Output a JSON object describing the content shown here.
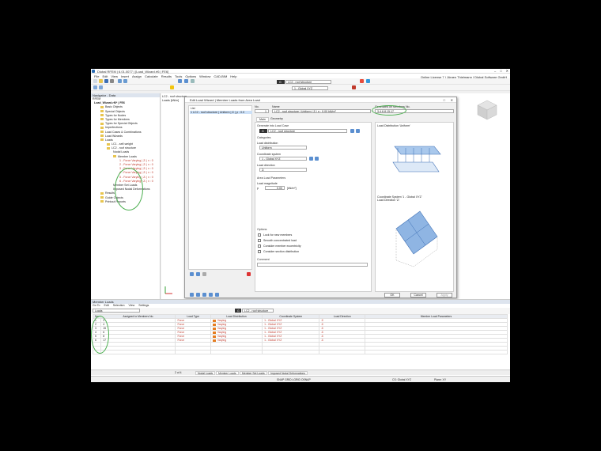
{
  "window": {
    "title": "Dlubal RFEM | 6.01.0077 | [Load_Wizard.rf6 | FE6]",
    "close": "✕"
  },
  "menu": [
    "File",
    "Edit",
    "View",
    "Insert",
    "Assign",
    "Calculate",
    "Results",
    "Tools",
    "Options",
    "Window",
    "CAD-BIM",
    "Help"
  ],
  "license": "Online License 7 | Jürgen Thielmann | Dlubal Software GmbH",
  "toolbar": {
    "loadcase_tag": "G",
    "loadcase": "LC2 - roof structure",
    "cs": "1 - Global XYZ"
  },
  "navigator": {
    "header": "Navigator - Data",
    "project": "RFEM",
    "model": "Load_Wizard.rf6* | FE6",
    "items": [
      "Basic Objects",
      "Special Objects",
      "Types for Nodes",
      "Types for Members",
      "Types for Special Objects",
      "Imperfections",
      "Load Cases & Combinations",
      "Load Wizards",
      "Loads",
      "LC1 - self-weight",
      "LC2 - roof structure",
      "Nodal Loads",
      "Member Loads",
      "1 - Force Varying | Zₗ | x : 0",
      "2 - Force Varying | Zₗ | x : 0",
      "3 - Force Varying | Zₗ | x : 0",
      "4 - Force Varying | Zₗ | x : 0",
      "5 - Force Varying | Zₗ | x : 0",
      "6 - Force Varying | Zₗ | x : 0",
      "Member Set Loads",
      "Imposed Nodal Deformations",
      "Results",
      "Guide Objects",
      "Printout Reports"
    ]
  },
  "viewport": {
    "line1": "LC2 - roof structure",
    "line2": "Loads [kN/m]",
    "cube": "+X"
  },
  "dialog": {
    "title": "Edit Load Wizard | Member Loads from Area Load",
    "list_header": "List",
    "list_item": "1  LC2 - roof structure | Uniform | Zₗ | p : 0.0",
    "no_label": "No.",
    "no_value": "1",
    "name_label": "Name",
    "name_value": "LC2 - roof structure | Uniform | Zₗ | p : 0.00 kN/m²",
    "gen_label": "Generated on Members No.",
    "gen_value": "3,4,6,8,15,17",
    "tabs": [
      "Main",
      "Geometry"
    ],
    "gen_lc_label": "Generate into Load Case",
    "gen_lc_tag": "G",
    "gen_lc_value": "LC2 - roof structure",
    "categories": "Categories",
    "dist_label": "Load distribution",
    "dist_value": "Uniform",
    "cs_label": "Coordinate system",
    "cs_value": "1 - Global XYZ",
    "dir_label": "Load direction",
    "dir_value": "Zₗ",
    "area_params": "Area Load Parameters",
    "mag_label": "Load magnitude",
    "p_label": "p",
    "p_value": "0.00",
    "p_unit": "[kN/m²]",
    "options": "Options",
    "opt": [
      "Lock for new members",
      "Smooth concentrated load",
      "Consider member eccentricity",
      "Consider section distribution"
    ],
    "comment": "Comment",
    "preview1": "Load Distribution 'Uniform'",
    "preview2": "Coordinate System '1 - Global XYZ'\nLoad Direction 'Zₗ'",
    "ok": "OK",
    "cancel": "Cancel",
    "apply": "Apply"
  },
  "bottom": {
    "header": "Member Loads",
    "menu": [
      "Go To",
      "Edit",
      "Selection",
      "View",
      "Settings"
    ],
    "cat": "Loads",
    "lc_tag": "G",
    "lc": "LC2 - roof structure",
    "cols": [
      "No.",
      "Assigned to Members No.",
      "Load Type",
      "Load Distribution",
      "Coordinate System",
      "Load Direction",
      "Member Load Parameters"
    ],
    "rows": [
      {
        "no": "1",
        "m": "3",
        "type": "Force",
        "dist": "Varying",
        "cs": "1 - Global XYZ",
        "dir": "Zₗ"
      },
      {
        "no": "2",
        "m": "4",
        "type": "Force",
        "dist": "Varying",
        "cs": "1 - Global XYZ",
        "dir": "Zₗ"
      },
      {
        "no": "3",
        "m": "15",
        "type": "Force",
        "dist": "Varying",
        "cs": "1 - Global XYZ",
        "dir": "Zₗ"
      },
      {
        "no": "4",
        "m": "6",
        "type": "Force",
        "dist": "Varying",
        "cs": "1 - Global XYZ",
        "dir": "Zₗ"
      },
      {
        "no": "5",
        "m": "8",
        "type": "Force",
        "dist": "Varying",
        "cs": "1 - Global XYZ",
        "dir": "Zₗ"
      },
      {
        "no": "6",
        "m": "17",
        "type": "Force",
        "dist": "Varying",
        "cs": "1 - Global XYZ",
        "dir": "Zₗ"
      }
    ],
    "pager": "2 of 4",
    "tabs": [
      "Nodal Loads",
      "Member Loads",
      "Member Set Loads",
      "Imposed Nodal Deformations"
    ]
  },
  "status": {
    "snaps": "SNAP  GRID  LGRID  OSNAP",
    "cs": "CS: Global XYZ",
    "plane": "Plane: XY"
  }
}
